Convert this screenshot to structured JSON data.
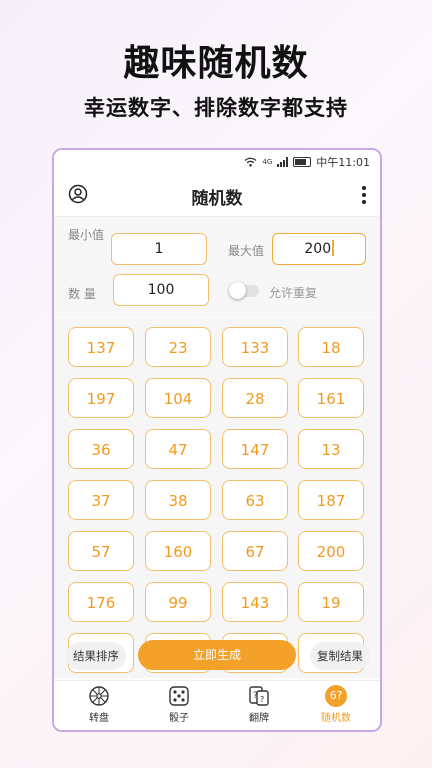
{
  "promo": {
    "title": "趣味随机数",
    "subtitle": "幸运数字、排除数字都支持"
  },
  "status_bar": {
    "network": "4G",
    "time": "中午11:01"
  },
  "app_bar": {
    "title": "随机数"
  },
  "settings": {
    "min_label": "最小值",
    "min_value": "1",
    "max_label": "最大值",
    "max_value": "200",
    "count_label": "数 量",
    "count_value": "100",
    "allow_repeat_label": "允许重复",
    "allow_repeat_on": false
  },
  "results": {
    "rows": [
      [
        "137",
        "23",
        "133",
        "18"
      ],
      [
        "197",
        "104",
        "28",
        "161"
      ],
      [
        "36",
        "47",
        "147",
        "13"
      ],
      [
        "37",
        "38",
        "63",
        "187"
      ],
      [
        "57",
        "160",
        "67",
        "200"
      ],
      [
        "176",
        "99",
        "143",
        "19"
      ]
    ]
  },
  "actions": {
    "sort": "结果排序",
    "generate": "立即生成",
    "copy": "复制结果"
  },
  "bottom_nav": {
    "items": [
      {
        "label": "转盘",
        "icon": "wheel-icon"
      },
      {
        "label": "骰子",
        "icon": "dice-icon"
      },
      {
        "label": "翻牌",
        "icon": "cards-icon"
      },
      {
        "label": "随机数",
        "icon": "random-number-icon",
        "badge": "6?"
      }
    ],
    "active_index": 3
  },
  "colors": {
    "accent": "#f4a12a",
    "accent_text": "#f39a1e",
    "cell_border": "#f2c06c",
    "frame": "#c9a6e6"
  }
}
